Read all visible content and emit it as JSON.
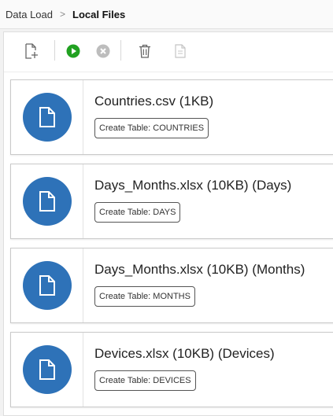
{
  "breadcrumb": {
    "parent": "Data Load",
    "separator": ">",
    "current": "Local Files"
  },
  "toolbar": {
    "icons": [
      "new-file-icon",
      "run-icon",
      "cancel-icon",
      "delete-icon",
      "document-icon"
    ],
    "colors": {
      "run": "#21a121",
      "disabled": "#bdbdbd",
      "default": "#666666"
    }
  },
  "files": [
    {
      "title": "Countries.csv (1KB)",
      "action": "Create Table: COUNTRIES"
    },
    {
      "title": "Days_Months.xlsx (10KB) (Days)",
      "action": "Create Table: DAYS"
    },
    {
      "title": "Days_Months.xlsx (10KB) (Months)",
      "action": "Create Table: MONTHS"
    },
    {
      "title": "Devices.xlsx (10KB) (Devices)",
      "action": "Create Table: DEVICES"
    }
  ],
  "accent_color": "#2e72b8"
}
